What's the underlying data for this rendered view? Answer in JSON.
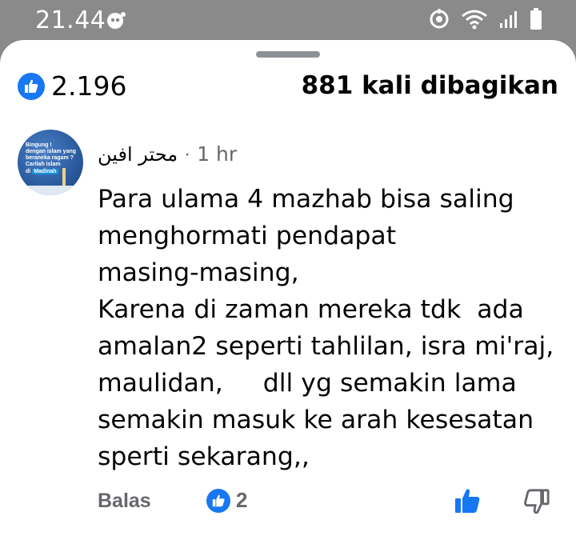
{
  "status_bar": {
    "time": "21.44"
  },
  "reactions": {
    "like_count": "2.196",
    "share_text": "881 kali dibagikan"
  },
  "avatar": {
    "lines": [
      "Bingung !",
      "dengan islam yang",
      "beraneka ragam ?",
      "Carilah islam",
      "di"
    ],
    "tag": "Madinah"
  },
  "comment": {
    "author": "محتر افين",
    "separator": "·",
    "time": "1 hr",
    "text": "Para ulama 4 mazhab bisa saling\nmenghormati pendapat\nmasing-masing,\nKarena di zaman mereka tdk  ada\namalan2 seperti tahlilan, isra mi'raj,\nmaulidan,     dll yg semakin lama\nsemakin masuk ke arah kesesatan\nsperti sekarang,,"
  },
  "actions": {
    "reply_label": "Balas",
    "like_count": "2"
  },
  "colors": {
    "accent": "#1877f2",
    "muted": "#65676b",
    "status_bar_bg": "#8a8a8a"
  },
  "icons": [
    "notification-icon",
    "add-circle-icon",
    "wifi-icon",
    "signal-icon",
    "battery-icon",
    "thumbs-up-icon",
    "thumbs-down-icon"
  ]
}
